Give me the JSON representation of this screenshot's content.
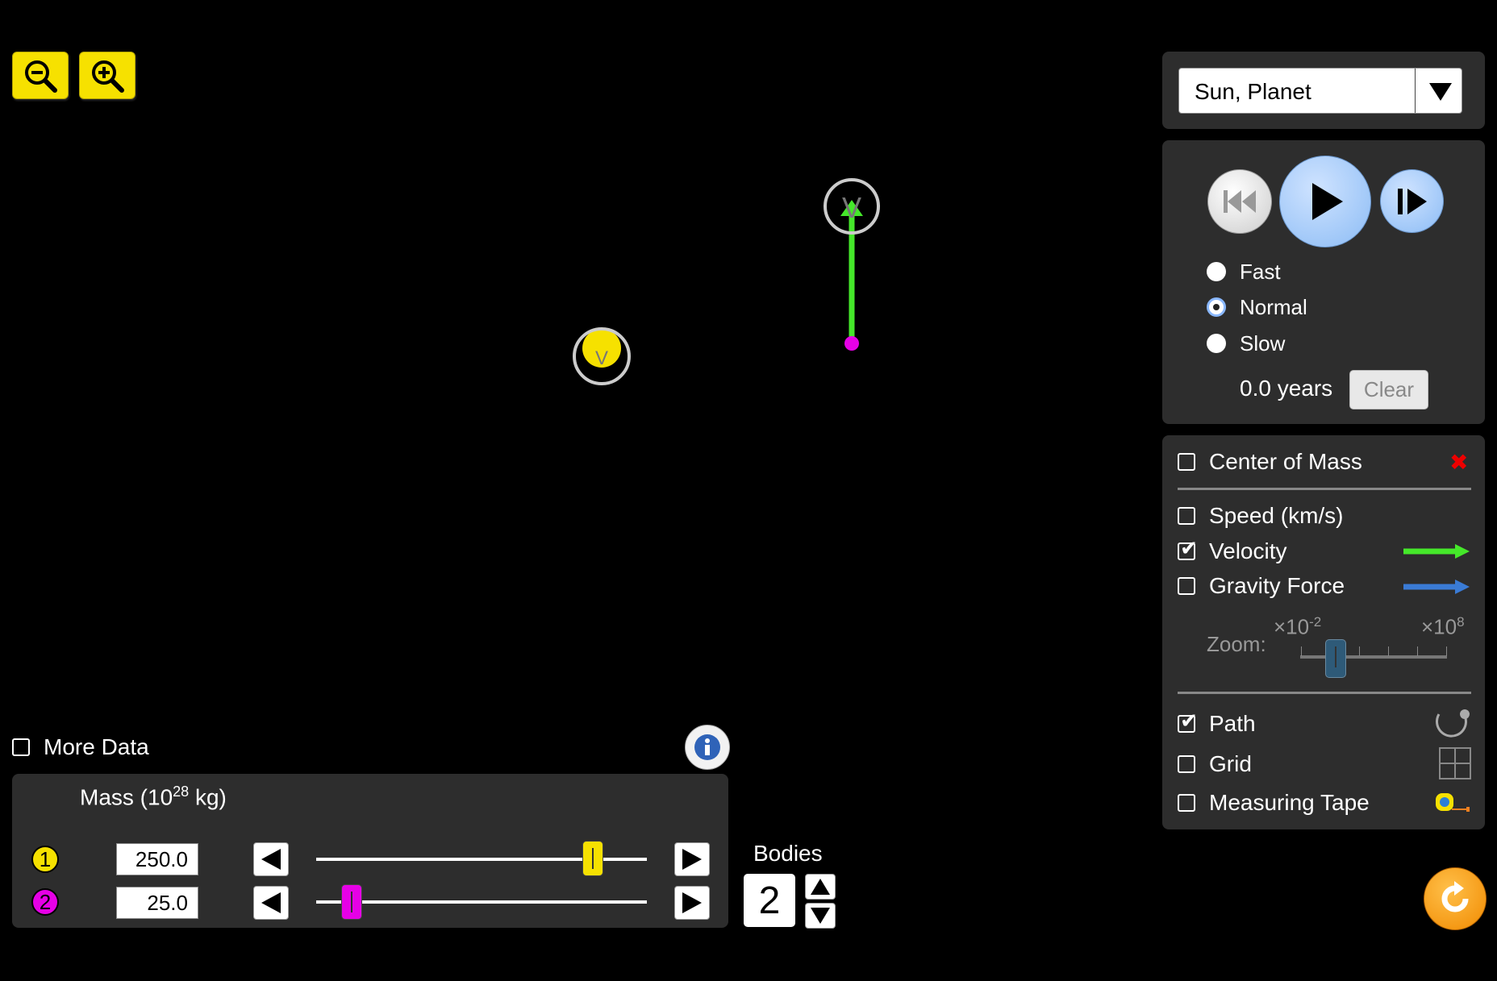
{
  "app": {
    "zoom_out_icon": "zoom-out-icon",
    "zoom_in_icon": "zoom-in-icon"
  },
  "preset": {
    "selected": "Sun, Planet"
  },
  "playback": {
    "speeds": [
      {
        "label": "Fast",
        "selected": false
      },
      {
        "label": "Normal",
        "selected": true
      },
      {
        "label": "Slow",
        "selected": false
      }
    ],
    "time": "0.0 years",
    "clear_label": "Clear"
  },
  "display": {
    "center_of_mass": {
      "label": "Center of Mass",
      "checked": false
    },
    "speed": {
      "label": "Speed (km/s)",
      "checked": false
    },
    "velocity": {
      "label": "Velocity",
      "checked": true,
      "color": "#45e82a"
    },
    "gravity": {
      "label": "Gravity Force",
      "checked": false,
      "color": "#3a7bd5"
    },
    "zoom": {
      "label": "Zoom:",
      "min_base": "×10",
      "min_exp": "-2",
      "max_base": "×10",
      "max_exp": "8",
      "level": 0.2
    },
    "path": {
      "label": "Path",
      "checked": true
    },
    "grid": {
      "label": "Grid",
      "checked": false
    },
    "tape": {
      "label": "Measuring Tape",
      "checked": false
    }
  },
  "more_data": {
    "label": "More Data",
    "checked": false
  },
  "mass": {
    "header_prefix": "Mass (10",
    "header_exp": "28",
    "header_suffix": " kg)",
    "bodies": [
      {
        "number": "1",
        "value": "250.0",
        "color": "#f6e100",
        "slider_level": 0.86
      },
      {
        "number": "2",
        "value": "25.0",
        "color": "#e600e6",
        "slider_level": 0.08
      }
    ]
  },
  "bodies_count": {
    "label": "Bodies",
    "value": "2"
  },
  "colors": {
    "sun": "#f6e100",
    "planet": "#e600e6",
    "panel": "#2d2d2d"
  }
}
